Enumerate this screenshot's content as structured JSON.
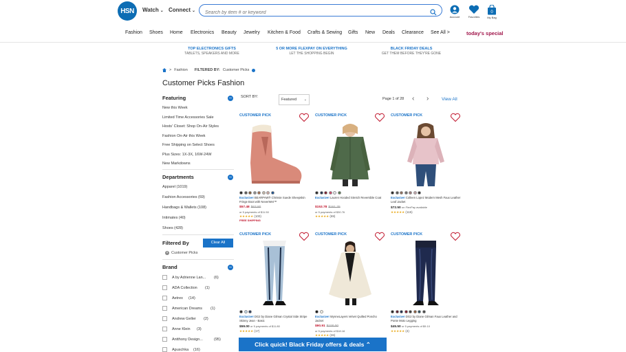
{
  "header": {
    "logo": "HSN",
    "watch": "Watch",
    "connect": "Connect",
    "search_placeholder": "Search by item # or keyword",
    "account": "Account",
    "favorites": "Favorites",
    "my_bag": "My Bag",
    "bag_count": "0"
  },
  "nav": [
    "Fashion",
    "Shoes",
    "Home",
    "Electronics",
    "Beauty",
    "Jewelry",
    "Kitchen & Food",
    "Crafts & Sewing",
    "Gifts",
    "New",
    "Deals",
    "Clearance",
    "See All >"
  ],
  "todays_special": "today's special",
  "promos": [
    {
      "title": "TOP ELECTRONICS GIFTS",
      "sub": "TABLETS, SPEAKERS AND MORE"
    },
    {
      "title": "5 OR MORE FLEXPAY ON EVERYTHING",
      "sub": "LET THE SHOPPING BEGIN"
    },
    {
      "title": "BLACK FRIDAY DEALS",
      "sub": "GET THEM BEFORE THEY'RE GONE"
    }
  ],
  "breadcrumb": {
    "home": "Fashion",
    "filtered_by": "FILTERED BY:",
    "filter": "Customer Picks"
  },
  "page_title": "Customer Picks Fashion",
  "featuring": {
    "title": "Featuring",
    "items": [
      "New this Week",
      "Limited Time Accessories Sale",
      "Hosts' Closet: Shop On-Air Styles",
      "Fashion On-Air this Week",
      "Free Shipping on Select Shoes",
      "Plus Sizes: 1X-3X, 16W-24W",
      "New Markdowns"
    ]
  },
  "departments": {
    "title": "Departments",
    "items": [
      {
        "label": "Apparel",
        "count": "(1019)"
      },
      {
        "label": "Fashion Accessories",
        "count": "(69)"
      },
      {
        "label": "Handbags & Wallets",
        "count": "(108)"
      },
      {
        "label": "Intimates",
        "count": "(40)"
      },
      {
        "label": "Shoes",
        "count": "(428)"
      }
    ]
  },
  "filtered_by": {
    "title": "Filtered By",
    "clear": "Clear All",
    "chip": "Customer Picks"
  },
  "brand": {
    "title": "Brand",
    "items": [
      {
        "label": "A by Adrienne Lan...",
        "count": "(6)"
      },
      {
        "label": "ADA Collection",
        "count": "(1)"
      },
      {
        "label": "Aetrex",
        "count": "(14)"
      },
      {
        "label": "American Dreams",
        "count": "(1)"
      },
      {
        "label": "Andrew Geller",
        "count": "(2)"
      },
      {
        "label": "Anne Klein",
        "count": "(3)"
      },
      {
        "label": "Antthony Design...",
        "count": "(95)"
      },
      {
        "label": "Apuschka",
        "count": "(16)"
      }
    ]
  },
  "sort": {
    "label": "SORT BY:",
    "value": "Featured"
  },
  "pager": {
    "text": "Page 1 of 28",
    "view_all": "View All"
  },
  "customer_pick_label": "CUSTOMER PICK",
  "products": [
    {
      "exclusive": "Exclusive!",
      "name": "BEARPAW® Chrissie Suede Sheepskin Fringe Boot with NeverWet™",
      "price": "$57.48",
      "was": "$63.80",
      "pay": "or 5 payments of $11.50",
      "reviews": "(100)",
      "ship": "FREE SHIPPING",
      "swatches": [
        "#222",
        "#555",
        "#7a5a3a",
        "#8a8a8a",
        "#9c6b4e",
        "#c3b7a6",
        "#c9a6a0",
        "#1a4e8a"
      ]
    },
    {
      "exclusive": "Exclusive!",
      "name": "Lauren Hooded Stretch Reversible Coat",
      "price": "$153.78",
      "was": "$161.25",
      "pay": "or 5 payments of $30.76",
      "reviews": "(69)",
      "ship": "",
      "swatches": [
        "#222",
        "#1f2d4a",
        "#7a1a2a",
        "#c94a6a",
        "#e8e8e8",
        "#557a4e"
      ]
    },
    {
      "exclusive": "Exclusive!",
      "name": "Colleen Lopez Modern Mesh Faux Leather Leaf Jacket",
      "price": "$72.50",
      "was": "",
      "pay": "on FlexPay available",
      "reviews": "(115)",
      "ship": "",
      "swatches": [
        "#222",
        "#555",
        "#8a6a5a",
        "#6a6a6a",
        "#9c7a7a",
        "#c2a3a8",
        "#2a2a2a"
      ]
    },
    {
      "exclusive": "Exclusive!",
      "name": "DG2 by Diane Gilman Crystal Side Stripe Skinny Jean - Basic",
      "price": "$59.00",
      "was": "",
      "pay": "or 5 payments of $11.80",
      "reviews": "(17)",
      "ship": "",
      "swatches": [
        "#222",
        "#bcd0e0",
        "#2a3a5a"
      ]
    },
    {
      "exclusive": "Exclusive!",
      "name": "WynneLayers Velvet Quilted Poncho Jacket",
      "price": "$90.91",
      "was": "$100.00",
      "pay": "or 5 payments of $18.18",
      "reviews": "(26)",
      "ship": "",
      "swatches": [
        "#111",
        "#f2efe6"
      ]
    },
    {
      "exclusive": "Exclusive!",
      "name": "DG2 by Diane Gilman Faux Leather and Ponte Moto Legging",
      "price": "$45.50",
      "was": "",
      "pay": "or 5 payments of $9.10",
      "reviews": "(4)",
      "ship": "",
      "swatches": [
        "#222",
        "#5a1a2a",
        "#1a2a4a",
        "#7a1a2a",
        "#3a3a3a",
        "#8a5a3a",
        "#2a4a5a",
        "#444"
      ]
    }
  ],
  "bottom_banner": "Click quick! Black Friday offers & deals  ⌃"
}
